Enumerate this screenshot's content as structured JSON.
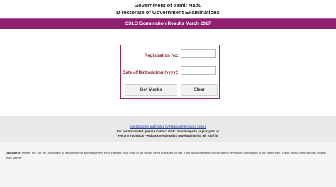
{
  "header": {
    "line1": "Government of Tamil Nadu",
    "line2": "Directorate of Government Examinations"
  },
  "banner": {
    "title": "SSLC Examination Results March 2017"
  },
  "form": {
    "registration_label": "Registration No:",
    "registration_value": "",
    "dob_label": "Date of Birth(dd/mm/yyyy):",
    "dob_value": "",
    "get_marks_label": "Get Marks",
    "clear_label": "Clear"
  },
  "footer": {
    "link_text": "Site Designed and hosted by National Informatics Centre",
    "queries_text": "For results related queries Contact DGE: directordge.tn [at] nic [dot] in",
    "feedback_text": "For any Technical Feedback send mail to tnwebadmin [at] nic [dot] in"
  },
  "disclaimer": {
    "heading": "Disclaimer:",
    "text": "Neither NIC nor the Directorate is responsible for any inadvertent error that may have crept in the results being published on Net. The results published on Net are for immediate information to the examinees. These cannot be treated as original mark sheets."
  },
  "colors": {
    "banner": "#8f1f6f",
    "label": "#8a1f2b",
    "form_border": "#9a2a5e"
  }
}
